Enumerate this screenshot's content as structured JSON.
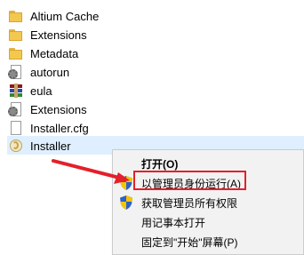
{
  "files": [
    {
      "name": "Altium Cache",
      "icon": "folder-icon"
    },
    {
      "name": "Extensions",
      "icon": "folder-icon"
    },
    {
      "name": "Metadata",
      "icon": "folder-icon"
    },
    {
      "name": "autorun",
      "icon": "settings-file-icon"
    },
    {
      "name": "eula",
      "icon": "winrar-archive-icon"
    },
    {
      "name": "Extensions",
      "icon": "settings-file-icon"
    },
    {
      "name": "Installer.cfg",
      "icon": "document-icon"
    },
    {
      "name": "Installer",
      "icon": "installer-icon"
    }
  ],
  "context_menu": {
    "items": [
      {
        "label": "打开(O)",
        "icon": "",
        "bold": true
      },
      {
        "label": "以管理员身份运行(A)",
        "icon": "uac-shield-icon",
        "bold": false
      },
      {
        "label": "获取管理员所有权限",
        "icon": "uac-shield-icon",
        "bold": false
      },
      {
        "label": "用记事本打开",
        "icon": "",
        "bold": false
      },
      {
        "label": "固定到\"开始\"屏幕(P)",
        "icon": "",
        "bold": false
      }
    ]
  },
  "colors": {
    "selection": "#dfefff",
    "menu_bg": "#f2f2f2",
    "annotation_red": "#e3202b"
  }
}
